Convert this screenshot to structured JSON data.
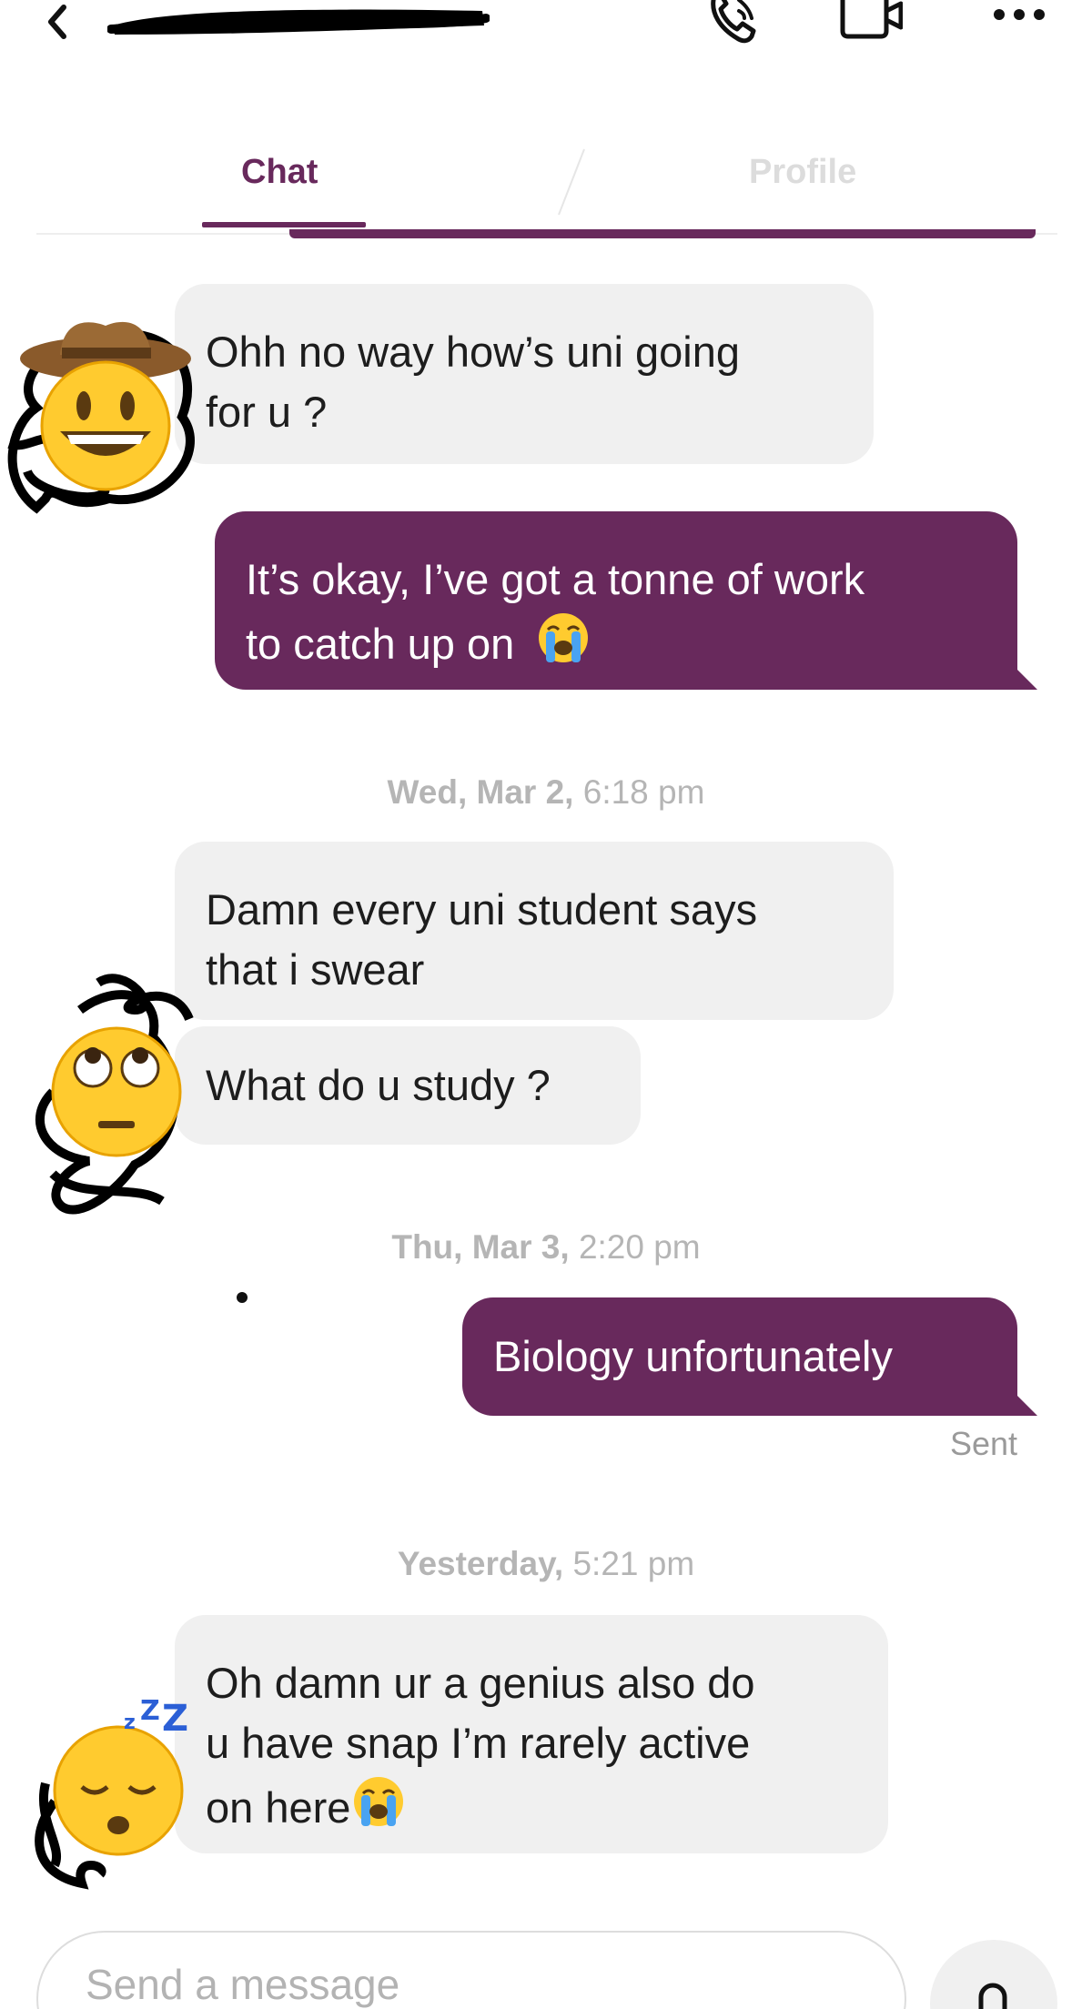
{
  "header": {
    "back_icon": "chevron-left-icon",
    "contact_name": "",
    "call_icon": "phone-icon",
    "video_icon": "video-camera-icon",
    "more_icon": "more-dots-icon"
  },
  "tabs": [
    {
      "label": "Chat",
      "active": true
    },
    {
      "label": "Profile",
      "active": false
    }
  ],
  "colors": {
    "accent": "#68295c",
    "incoming_bubble": "#f0f0f0",
    "stamp_text": "#b5b5b5"
  },
  "conversation": {
    "messages": [
      {
        "direction": "incoming",
        "lines": [
          "Ohh no way how’s uni going",
          "for u ?"
        ]
      },
      {
        "direction": "outgoing",
        "lines": [
          "It’s okay, I’ve got a tonne of work",
          "to catch up on"
        ],
        "trailing_emoji": "loudly-crying-face"
      },
      {
        "direction": "incoming",
        "lines": [
          "Damn every uni student says",
          "that i swear"
        ]
      },
      {
        "direction": "incoming",
        "lines": [
          "What do u study ?"
        ]
      },
      {
        "direction": "outgoing",
        "lines": [
          "Biology unfortunately"
        ],
        "status": "Sent"
      },
      {
        "direction": "incoming",
        "lines": [
          "Oh damn ur a genius also do",
          "u have snap I’m rarely active",
          "on here"
        ],
        "trailing_emoji": "loudly-crying-face"
      }
    ],
    "timestamps": [
      {
        "day": "Wed, Mar 2,",
        "time": "6:18 pm"
      },
      {
        "day": "Thu, Mar 3,",
        "time": "2:20 pm"
      },
      {
        "day": "Yesterday,",
        "time": "5:21 pm"
      }
    ],
    "avatars": [
      "cowboy-hat-face",
      "face-with-rolling-eyes",
      "sleeping-face"
    ]
  },
  "composer": {
    "placeholder": "Send a message",
    "mic_icon": "microphone-icon"
  }
}
